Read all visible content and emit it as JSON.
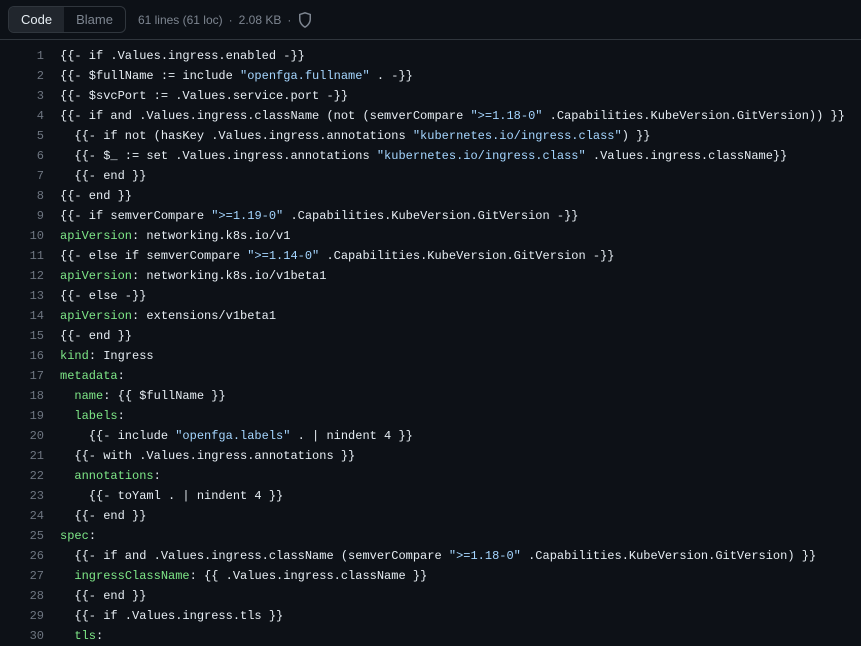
{
  "header": {
    "tab_code": "Code",
    "tab_blame": "Blame",
    "info_lines": "61 lines (61 loc)",
    "info_size": "2.08 KB"
  },
  "code": {
    "lines": [
      [
        [
          "tmpl",
          "{{- if .Values.ingress.enabled -}}"
        ]
      ],
      [
        [
          "tmpl",
          "{{- $fullName := include "
        ],
        [
          "str",
          "\"openfga.fullname\""
        ],
        [
          "tmpl",
          " . -}}"
        ]
      ],
      [
        [
          "tmpl",
          "{{- $svcPort := .Values.service.port -}}"
        ]
      ],
      [
        [
          "tmpl",
          "{{- if and .Values.ingress.className (not (semverCompare "
        ],
        [
          "str",
          "\">=1.18-0\""
        ],
        [
          "tmpl",
          " .Capabilities.KubeVersion.GitVersion)) }}"
        ]
      ],
      [
        [
          "tmpl",
          "  {{- if not (hasKey .Values.ingress.annotations "
        ],
        [
          "str",
          "\"kubernetes.io/ingress.class\""
        ],
        [
          "tmpl",
          ") }}"
        ]
      ],
      [
        [
          "tmpl",
          "  {{- $_ := set .Values.ingress.annotations "
        ],
        [
          "str",
          "\"kubernetes.io/ingress.class\""
        ],
        [
          "tmpl",
          " .Values.ingress.className}}"
        ]
      ],
      [
        [
          "tmpl",
          "  {{- end }}"
        ]
      ],
      [
        [
          "tmpl",
          "{{- end }}"
        ]
      ],
      [
        [
          "tmpl",
          "{{- if semverCompare "
        ],
        [
          "str",
          "\">=1.19-0\""
        ],
        [
          "tmpl",
          " .Capabilities.KubeVersion.GitVersion -}}"
        ]
      ],
      [
        [
          "key",
          "apiVersion"
        ],
        [
          "col",
          ": "
        ],
        [
          "plain",
          "networking.k8s.io/v1"
        ]
      ],
      [
        [
          "tmpl",
          "{{- else if semverCompare "
        ],
        [
          "str",
          "\">=1.14-0\""
        ],
        [
          "tmpl",
          " .Capabilities.KubeVersion.GitVersion -}}"
        ]
      ],
      [
        [
          "key",
          "apiVersion"
        ],
        [
          "col",
          ": "
        ],
        [
          "plain",
          "networking.k8s.io/v1beta1"
        ]
      ],
      [
        [
          "tmpl",
          "{{- else -}}"
        ]
      ],
      [
        [
          "key",
          "apiVersion"
        ],
        [
          "col",
          ": "
        ],
        [
          "plain",
          "extensions/v1beta1"
        ]
      ],
      [
        [
          "tmpl",
          "{{- end }}"
        ]
      ],
      [
        [
          "key",
          "kind"
        ],
        [
          "col",
          ": "
        ],
        [
          "plain",
          "Ingress"
        ]
      ],
      [
        [
          "key",
          "metadata"
        ],
        [
          "col",
          ":"
        ]
      ],
      [
        [
          "plain",
          "  "
        ],
        [
          "key",
          "name"
        ],
        [
          "col",
          ": "
        ],
        [
          "tmpl",
          "{{ $fullName }}"
        ]
      ],
      [
        [
          "plain",
          "  "
        ],
        [
          "key",
          "labels"
        ],
        [
          "col",
          ":"
        ]
      ],
      [
        [
          "tmpl",
          "    {{- include "
        ],
        [
          "str",
          "\"openfga.labels\""
        ],
        [
          "tmpl",
          " . | nindent 4 }}"
        ]
      ],
      [
        [
          "tmpl",
          "  {{- with .Values.ingress.annotations }}"
        ]
      ],
      [
        [
          "plain",
          "  "
        ],
        [
          "key",
          "annotations"
        ],
        [
          "col",
          ":"
        ]
      ],
      [
        [
          "tmpl",
          "    {{- toYaml . | nindent 4 }}"
        ]
      ],
      [
        [
          "tmpl",
          "  {{- end }}"
        ]
      ],
      [
        [
          "key",
          "spec"
        ],
        [
          "col",
          ":"
        ]
      ],
      [
        [
          "tmpl",
          "  {{- if and .Values.ingress.className (semverCompare "
        ],
        [
          "str",
          "\">=1.18-0\""
        ],
        [
          "tmpl",
          " .Capabilities.KubeVersion.GitVersion) }}"
        ]
      ],
      [
        [
          "plain",
          "  "
        ],
        [
          "key",
          "ingressClassName"
        ],
        [
          "col",
          ": "
        ],
        [
          "tmpl",
          "{{ .Values.ingress.className }}"
        ]
      ],
      [
        [
          "tmpl",
          "  {{- end }}"
        ]
      ],
      [
        [
          "tmpl",
          "  {{- if .Values.ingress.tls }}"
        ]
      ],
      [
        [
          "plain",
          "  "
        ],
        [
          "key",
          "tls"
        ],
        [
          "col",
          ":"
        ]
      ]
    ]
  }
}
